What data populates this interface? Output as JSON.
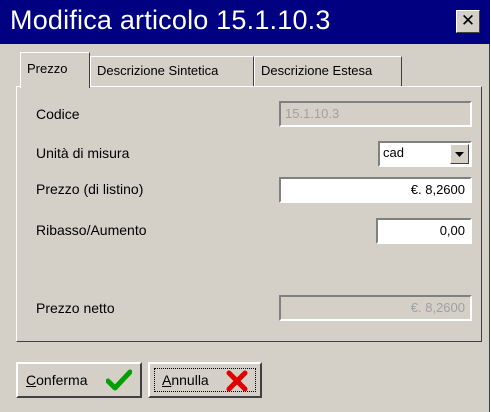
{
  "window": {
    "title": "Modifica articolo 15.1.10.3",
    "close_glyph": "✕"
  },
  "tabs": [
    {
      "label": "Prezzo",
      "active": true
    },
    {
      "label": "Descrizione Sintetica",
      "active": false
    },
    {
      "label": "Descrizione Estesa",
      "active": false
    }
  ],
  "form": {
    "codice": {
      "label": "Codice",
      "value": "15.1.10.3",
      "enabled": false
    },
    "unita_misura": {
      "label": "Unità di misura",
      "value": "cad"
    },
    "prezzo_listino": {
      "label": "Prezzo (di listino)",
      "value": "€. 8,2600",
      "enabled": true
    },
    "ribasso_aumento": {
      "label": "Ribasso/Aumento",
      "value": "0,00",
      "enabled": true
    },
    "prezzo_netto": {
      "label": "Prezzo netto",
      "value": "€. 8,2600",
      "enabled": false
    }
  },
  "buttons": {
    "conferma": {
      "label": "Conferma",
      "icon": "check-icon",
      "icon_color": "#00a000"
    },
    "annulla": {
      "label": "Annulla",
      "icon": "x-icon",
      "icon_color": "#e00000"
    }
  },
  "colors": {
    "titlebar": "#000080",
    "face": "#d4d0c8"
  }
}
